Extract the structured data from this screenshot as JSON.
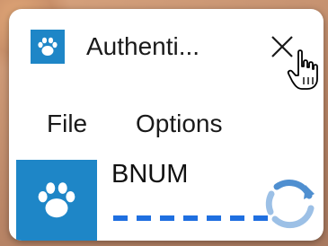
{
  "window": {
    "title": "Authenti...",
    "app_icon": "paw-icon",
    "close_icon": "close-icon"
  },
  "menu": {
    "items": [
      {
        "label": "File"
      },
      {
        "label": "Options"
      }
    ]
  },
  "entry": {
    "account_name": "BNUM",
    "icon": "paw-icon",
    "code_hidden_count": 7,
    "refresh_icon": "refresh-icon"
  },
  "colors": {
    "accent": "#1e86c7",
    "code_dash": "#1f6fe0",
    "refresh_ring": "#4f8fd0"
  }
}
